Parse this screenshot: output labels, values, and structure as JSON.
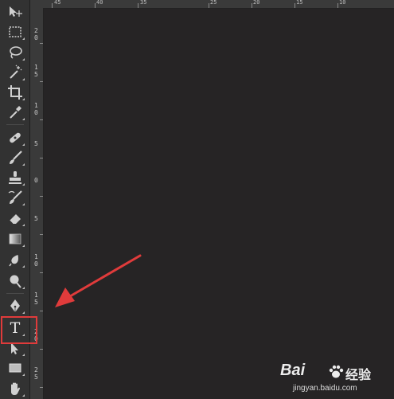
{
  "toolbar": {
    "tools": [
      {
        "name": "move-tool"
      },
      {
        "name": "marquee-tool"
      },
      {
        "name": "lasso-tool"
      },
      {
        "name": "magic-wand-tool"
      },
      {
        "name": "crop-tool"
      },
      {
        "name": "eyedropper-tool"
      },
      {
        "name": "healing-brush-tool"
      },
      {
        "name": "brush-tool"
      },
      {
        "name": "clone-stamp-tool"
      },
      {
        "name": "history-brush-tool"
      },
      {
        "name": "eraser-tool"
      },
      {
        "name": "gradient-tool"
      },
      {
        "name": "blur-tool"
      },
      {
        "name": "dodge-tool"
      },
      {
        "name": "pen-tool"
      },
      {
        "name": "type-tool",
        "label": "T"
      },
      {
        "name": "path-selection-tool"
      },
      {
        "name": "rectangle-tool"
      },
      {
        "name": "hand-tool"
      }
    ]
  },
  "ruler_left": {
    "labels": [
      "2\n0",
      "1\n5",
      "1\n0",
      "5",
      "0",
      "5",
      "1\n0",
      "1\n5",
      "2\n0",
      "2\n5"
    ]
  },
  "ruler_top": {
    "labels": [
      "45",
      "40",
      "35",
      "25",
      "20",
      "15",
      "10"
    ]
  },
  "annotation": {
    "highlight_color": "#e03b3b",
    "arrow_color": "#e03b3b",
    "highlighted_tool": "type-tool"
  },
  "watermark": {
    "logo_text": "Bai",
    "logo_suffix": "经验",
    "url": "jingyan.baidu.com"
  }
}
